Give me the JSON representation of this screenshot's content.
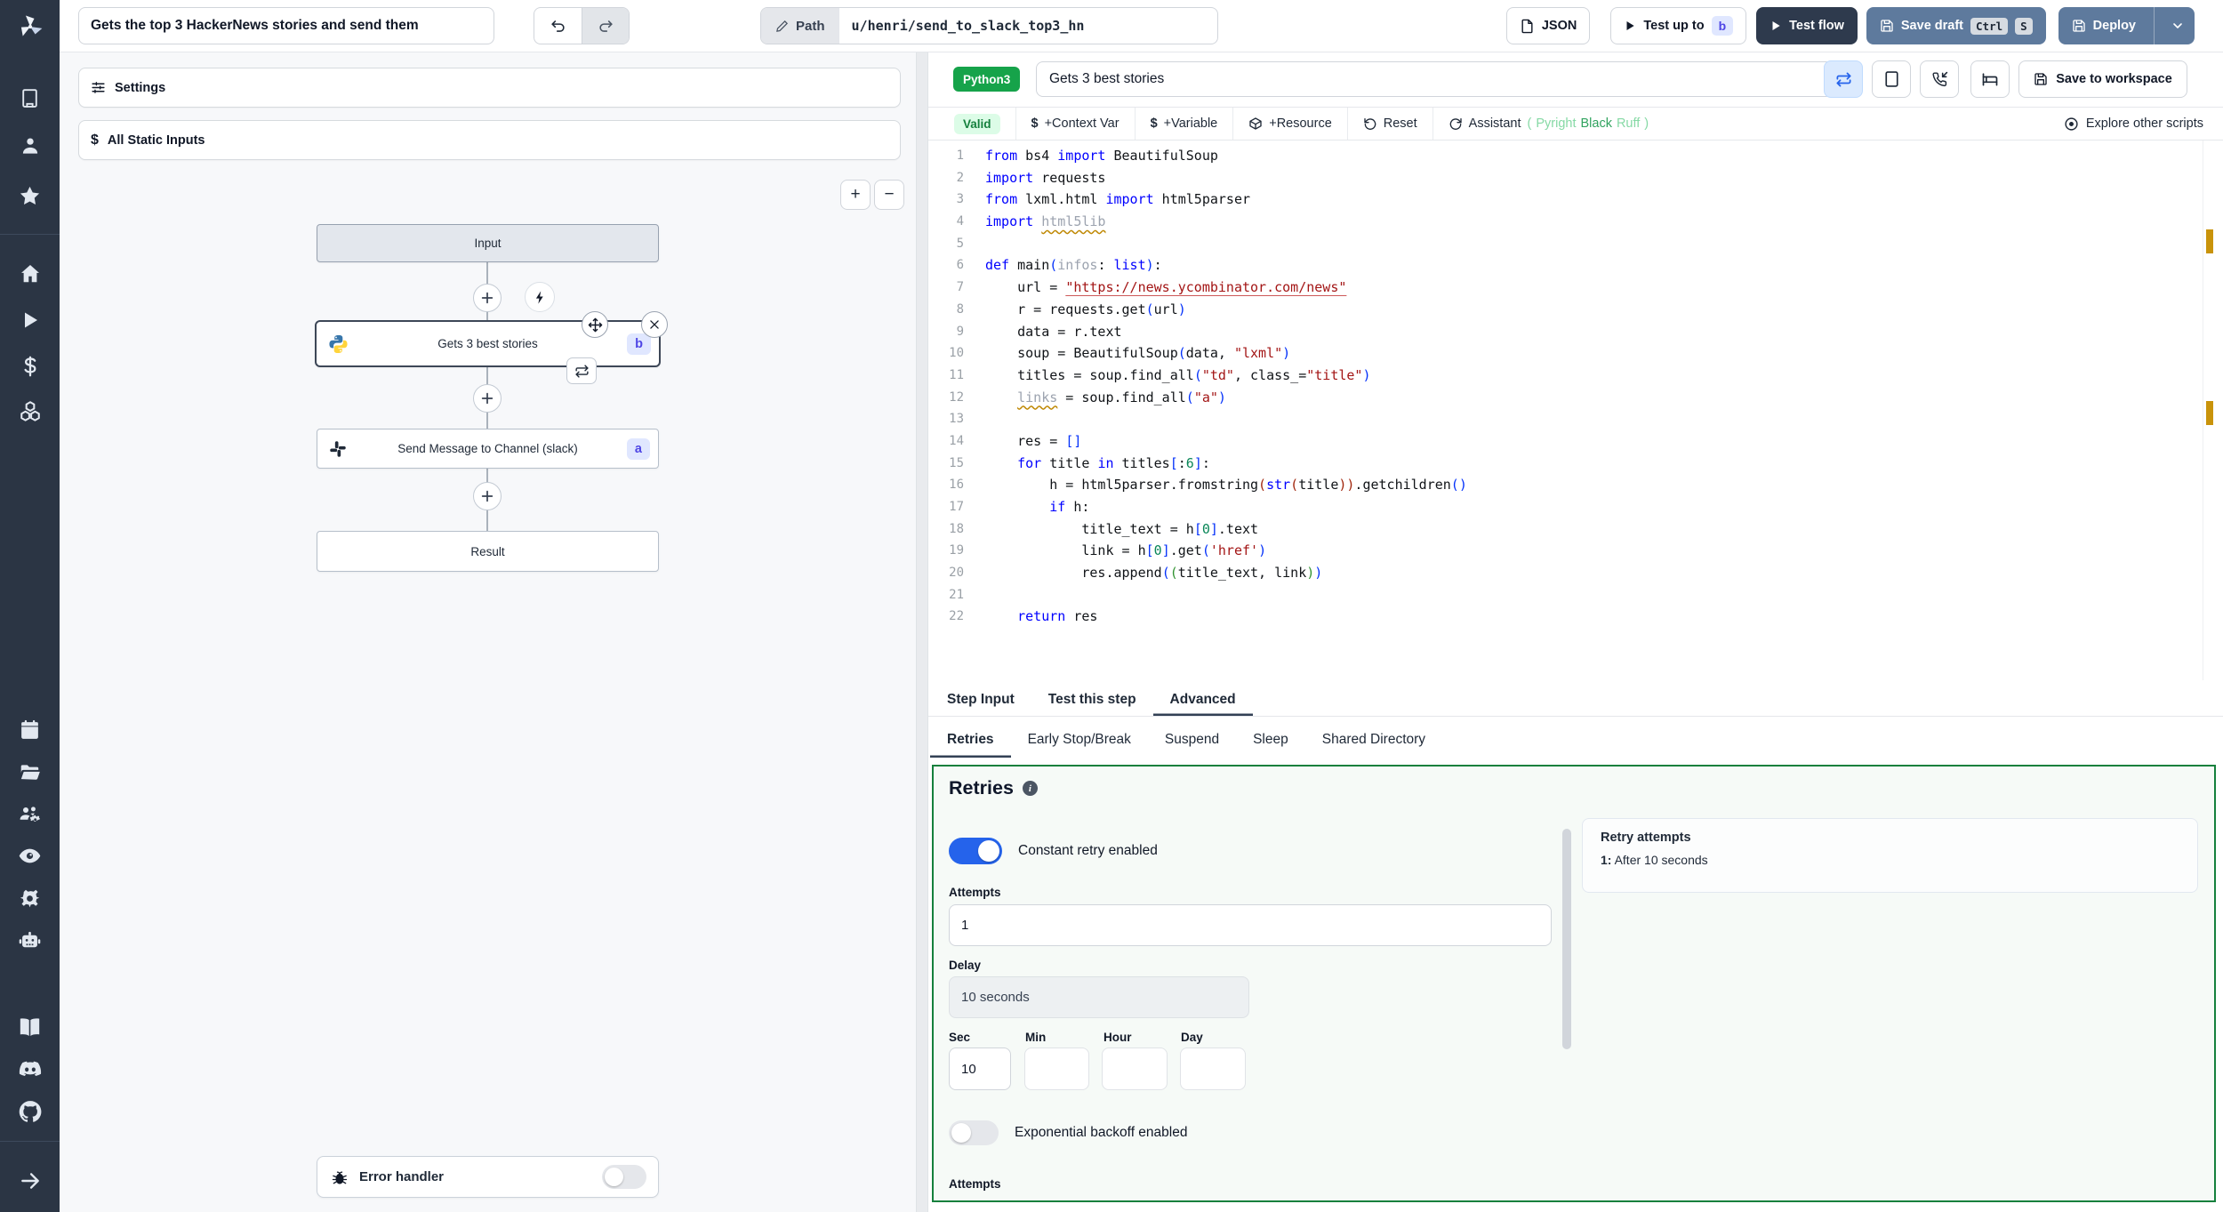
{
  "colors": {
    "sidebar_bg": "#2b3544",
    "accent_blue_toggle": "#2563eb",
    "valid_green": "#15803d",
    "retries_border_green": "#15803d",
    "lang_badge_green": "#16a34a",
    "branch_badge_indigo": "#4f46e5",
    "topbar_slate_button": "#5e7a9d",
    "dark_button": "#2e3a4d",
    "warning_marker_orange": "#c9930a"
  },
  "sidebar": {
    "icons": [
      "windmill-logo",
      "building",
      "user",
      "star",
      "home",
      "play",
      "dollar",
      "boxes",
      "calendar",
      "folder-open",
      "users-settings",
      "eye",
      "gear",
      "robot",
      "book",
      "discord",
      "github",
      "arrow-right"
    ]
  },
  "topbar": {
    "flow_title": "Gets the top 3 HackerNews stories and send them",
    "path_label": "Path",
    "path_value": "u/henri/send_to_slack_top3_hn",
    "json_button": "JSON",
    "test_up_to": "Test up to",
    "test_up_to_badge": "b",
    "test_flow": "Test flow",
    "save_draft": "Save draft",
    "kbd_ctrl": "Ctrl",
    "kbd_s": "S",
    "deploy": "Deploy"
  },
  "flow": {
    "settings": "Settings",
    "all_static_inputs": "All Static Inputs",
    "zoom_in": "+",
    "zoom_out": "−",
    "input_node": "Input",
    "step_b_label": "Gets 3 best stories",
    "step_b_badge": "b",
    "step_a_label": "Send Message to Channel (slack)",
    "step_a_badge": "a",
    "result_node": "Result",
    "error_handler": "Error handler"
  },
  "editor": {
    "lang_badge": "Python3",
    "step_name": "Gets 3 best stories",
    "save_to_workspace": "Save to workspace",
    "toolbar": {
      "valid": "Valid",
      "context_var": "+Context Var",
      "variable": "+Variable",
      "resource": "+Resource",
      "reset": "Reset",
      "assistant": "Assistant",
      "assistant_paren_open": "(",
      "pyright": "Pyright",
      "black": "Black",
      "ruff": "Ruff",
      "assistant_paren_close": ")",
      "explore": "Explore other scripts"
    },
    "code": {
      "lines": [
        [
          [
            "k",
            "from"
          ],
          [
            "d",
            " bs4 "
          ],
          [
            "k",
            "import"
          ],
          [
            "d",
            " BeautifulSoup"
          ]
        ],
        [
          [
            "k",
            "import"
          ],
          [
            "d",
            " requests"
          ]
        ],
        [
          [
            "k",
            "from"
          ],
          [
            "d",
            " lxml.html "
          ],
          [
            "k",
            "import"
          ],
          [
            "d",
            " html5parser"
          ]
        ],
        [
          [
            "k",
            "import"
          ],
          [
            "d",
            " "
          ],
          [
            "gu",
            "html5lib"
          ]
        ],
        [],
        [
          [
            "k",
            "def"
          ],
          [
            "d",
            " main"
          ],
          [
            "pb",
            "("
          ],
          [
            "g",
            "infos"
          ],
          [
            "d",
            ": "
          ],
          [
            "k",
            "list"
          ],
          [
            "pb",
            ")"
          ],
          [
            "d",
            ":"
          ]
        ],
        [
          [
            "d",
            "    url = "
          ],
          [
            "su",
            "\"https://news.ycombinator.com/news\""
          ]
        ],
        [
          [
            "d",
            "    r = requests.get"
          ],
          [
            "pb",
            "("
          ],
          [
            "d",
            "url"
          ],
          [
            "pb",
            ")"
          ]
        ],
        [
          [
            "d",
            "    data = r.text"
          ]
        ],
        [
          [
            "d",
            "    soup = BeautifulSoup"
          ],
          [
            "pb",
            "("
          ],
          [
            "d",
            "data, "
          ],
          [
            "s",
            "\"lxml\""
          ],
          [
            "pb",
            ")"
          ]
        ],
        [
          [
            "d",
            "    titles = soup.find_all"
          ],
          [
            "pb",
            "("
          ],
          [
            "s",
            "\"td\""
          ],
          [
            "d",
            ", class_="
          ],
          [
            "s",
            "\"title\""
          ],
          [
            "pb",
            ")"
          ]
        ],
        [
          [
            "d",
            "    "
          ],
          [
            "gu",
            "links"
          ],
          [
            "d",
            " = soup.find_all"
          ],
          [
            "pb",
            "("
          ],
          [
            "s",
            "\"a\""
          ],
          [
            "pb",
            ")"
          ]
        ],
        [],
        [
          [
            "d",
            "    res = "
          ],
          [
            "pb",
            "[]"
          ]
        ],
        [
          [
            "d",
            "    "
          ],
          [
            "k",
            "for"
          ],
          [
            "d",
            " title "
          ],
          [
            "k",
            "in"
          ],
          [
            "d",
            " titles"
          ],
          [
            "pb",
            "["
          ],
          [
            "d",
            ":"
          ],
          [
            "n",
            "6"
          ],
          [
            "pb",
            "]"
          ],
          [
            "d",
            ":"
          ]
        ],
        [
          [
            "d",
            "        h = html5parser.fromstring"
          ],
          [
            "pr",
            "("
          ],
          [
            "k",
            "str"
          ],
          [
            "pr",
            "("
          ],
          [
            "d",
            "title"
          ],
          [
            "pr",
            ")"
          ],
          [
            "pr",
            ")"
          ],
          [
            "d",
            ".getchildren"
          ],
          [
            "pb",
            "()"
          ]
        ],
        [
          [
            "d",
            "        "
          ],
          [
            "k",
            "if"
          ],
          [
            "d",
            " h:"
          ]
        ],
        [
          [
            "d",
            "            title_text = h"
          ],
          [
            "pb",
            "["
          ],
          [
            "n",
            "0"
          ],
          [
            "pb",
            "]"
          ],
          [
            "d",
            ".text"
          ]
        ],
        [
          [
            "d",
            "            link = h"
          ],
          [
            "pb",
            "["
          ],
          [
            "n",
            "0"
          ],
          [
            "pb",
            "]"
          ],
          [
            "d",
            ".get"
          ],
          [
            "pb",
            "("
          ],
          [
            "s",
            "'href'"
          ],
          [
            "pb",
            ")"
          ]
        ],
        [
          [
            "d",
            "            res.append"
          ],
          [
            "pb",
            "("
          ],
          [
            "pg",
            "("
          ],
          [
            "d",
            "title_text, link"
          ],
          [
            "pg",
            ")"
          ],
          [
            "pb",
            ")"
          ]
        ],
        [],
        [
          [
            "d",
            "    "
          ],
          [
            "k",
            "return"
          ],
          [
            "d",
            " res"
          ]
        ]
      ]
    }
  },
  "tabs": {
    "step_input": "Step Input",
    "test_this_step": "Test this step",
    "advanced": "Advanced",
    "retries": "Retries",
    "early_stop": "Early Stop/Break",
    "suspend": "Suspend",
    "sleep": "Sleep",
    "shared_directory": "Shared Directory"
  },
  "retries": {
    "title": "Retries",
    "constant_label": "Constant retry enabled",
    "attempts_label": "Attempts",
    "attempts_value": "1",
    "delay_label": "Delay",
    "delay_value": "10 seconds",
    "sec": "Sec",
    "min": "Min",
    "hour": "Hour",
    "day": "Day",
    "sec_value": "10",
    "exponential_label": "Exponential backoff enabled",
    "attempts_label_2": "Attempts",
    "summary_title": "Retry attempts",
    "summary_item_prefix": "1:",
    "summary_item_text": "After 10 seconds"
  }
}
